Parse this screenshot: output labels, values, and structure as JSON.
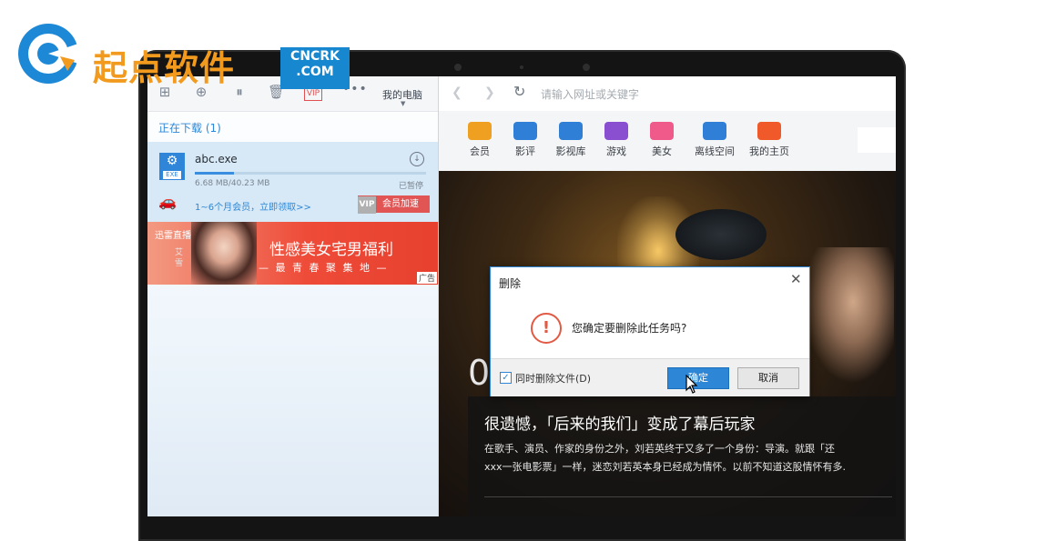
{
  "watermark": {
    "brand_text": "起点软件",
    "badge_line1": "CNCRK",
    "badge_line2": ".COM"
  },
  "download_manager": {
    "toolbar": {
      "icons": [
        "add-icon",
        "download-icon",
        "pause-icon",
        "trash-icon"
      ],
      "vip_label": "VIP",
      "more_label": "•••",
      "location_label": "我的电脑"
    },
    "section_heading": "正在下载 (1)",
    "item": {
      "filename": "abc.exe",
      "file_type_label": "EXE",
      "progress": 0.17,
      "size_text": "6.68 MB/40.23 MB",
      "status": "已暂停",
      "promo_text": "1~6个月会员，立即领取>>",
      "vip_badge": "VIP",
      "accelerate_label": "会员加速"
    },
    "ad": {
      "brand": "迅雷直播",
      "side_text": "艾雪",
      "title": "性感美女宅男福利",
      "subtitle": "— 最 青 春 聚 集 地 —",
      "tag": "广告"
    }
  },
  "browser": {
    "address_placeholder": "请输入网址或关键字",
    "categories": [
      {
        "label": "会员",
        "color": "#f0a020",
        "icon": "gift-icon"
      },
      {
        "label": "影评",
        "color": "#2f7fd6",
        "icon": "review-icon"
      },
      {
        "label": "影视库",
        "color": "#2f7fd6",
        "icon": "film-library-icon"
      },
      {
        "label": "游戏",
        "color": "#8a4fd0",
        "icon": "game-icon"
      },
      {
        "label": "美女",
        "color": "#ef5a8a",
        "icon": "mask-icon"
      },
      {
        "label": "离线空间",
        "color": "#2f7fd6",
        "icon": "cloud-icon"
      },
      {
        "label": "我的主页",
        "color": "#f05a2a",
        "icon": "home-icon"
      }
    ],
    "hero": {
      "number": "0",
      "title": "很遗憾，「后来的我们」变成了幕后玩家",
      "body_line1": "在歌手、演员、作家的身份之外，刘若英终于又多了一个身份：导演。就跟「还",
      "body_line2": "xxx一张电影票」一样，迷恋刘若英本身已经成为情怀。以前不知道这股情怀有多."
    }
  },
  "dialog": {
    "title": "删除",
    "message": "您确定要删除此任务吗?",
    "checkbox_label": "同时删除文件(D)",
    "checkbox_checked": true,
    "ok_label": "确定",
    "cancel_label": "取消"
  }
}
